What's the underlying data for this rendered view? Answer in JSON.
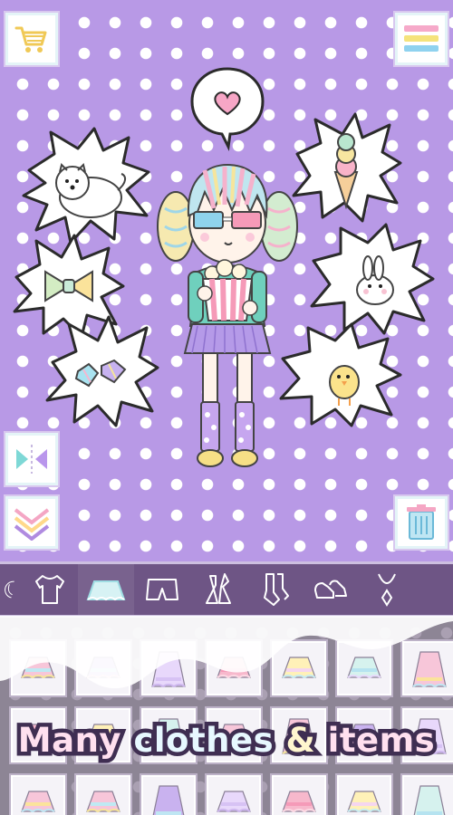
{
  "promo": {
    "caption": "Many clothes & items"
  },
  "toolbar": {
    "cart_icon": "shopping-cart-icon",
    "menu_icon": "rainbow-menu-icon",
    "flip_icon": "flip-mirror-icon",
    "collapse_icon": "double-chevron-down-icon",
    "trash_icon": "trash-can-icon"
  },
  "stickers": [
    "heart",
    "white-dog",
    "bow",
    "gems",
    "ice-cream",
    "bunny",
    "chick"
  ],
  "categories": [
    {
      "name": "hair",
      "active": false
    },
    {
      "name": "top",
      "active": false
    },
    {
      "name": "skirt",
      "active": true
    },
    {
      "name": "pants",
      "active": false
    },
    {
      "name": "dress",
      "active": false
    },
    {
      "name": "socks",
      "active": false
    },
    {
      "name": "shoes",
      "active": false
    },
    {
      "name": "accessory",
      "active": false
    }
  ],
  "colors": {
    "background": "#b899e6",
    "dots": "#ffffff",
    "category_bar": "#6e5585",
    "panel": "#8d8595"
  }
}
